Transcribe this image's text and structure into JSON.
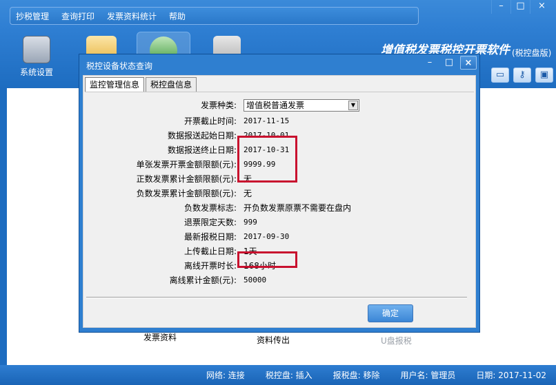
{
  "menu": [
    "抄税管理",
    "查询打印",
    "发票资料统计",
    "帮助"
  ],
  "window_controls": [
    "–",
    "□",
    "×"
  ],
  "brand": {
    "title": "增值税发票税控开票软件",
    "subtitle": "(税控盘版)"
  },
  "toolbar": {
    "settings_label": "系统设置"
  },
  "workspace_labels": {
    "invoice_data": "发票资料",
    "data_upload": "资料传出",
    "usb_tax": "U盘报税"
  },
  "dialog": {
    "title": "税控设备状态查询",
    "controls": [
      "–",
      "□",
      "×"
    ],
    "tabs": [
      "监控管理信息",
      "税控盘信息"
    ],
    "invoice_type_label": "发票种类:",
    "invoice_type_value": "增值税普通发票",
    "fields": [
      {
        "label": "开票截止时间:",
        "value": "2017-11-15"
      },
      {
        "label": "数据报送起始日期:",
        "value": "2017-10-01"
      },
      {
        "label": "数据报送终止日期:",
        "value": "2017-10-31"
      },
      {
        "label": "单张发票开票金额限额(元):",
        "value": "9999.99"
      },
      {
        "label": "正数发票累计金额限额(元):",
        "value": "无"
      },
      {
        "label": "负数发票累计金额限额(元):",
        "value": "无"
      },
      {
        "label": "负数发票标志:",
        "value": "开负数发票原票不需要在盘内"
      },
      {
        "label": "退票限定天数:",
        "value": "999"
      },
      {
        "label": "最新报税日期:",
        "value": "2017-09-30"
      },
      {
        "label": "上传截止日期:",
        "value": "1天"
      },
      {
        "label": "离线开票时长:",
        "value": "168小时"
      },
      {
        "label": "离线累计金额(元):",
        "value": "50000"
      }
    ],
    "ok_label": "确定"
  },
  "status": {
    "network": "网络: 连接",
    "tax_disk": "税控盘: 插入",
    "report_disk": "报税盘: 移除",
    "user": "用户名: 管理员",
    "date": "日期: 2017-11-02"
  }
}
